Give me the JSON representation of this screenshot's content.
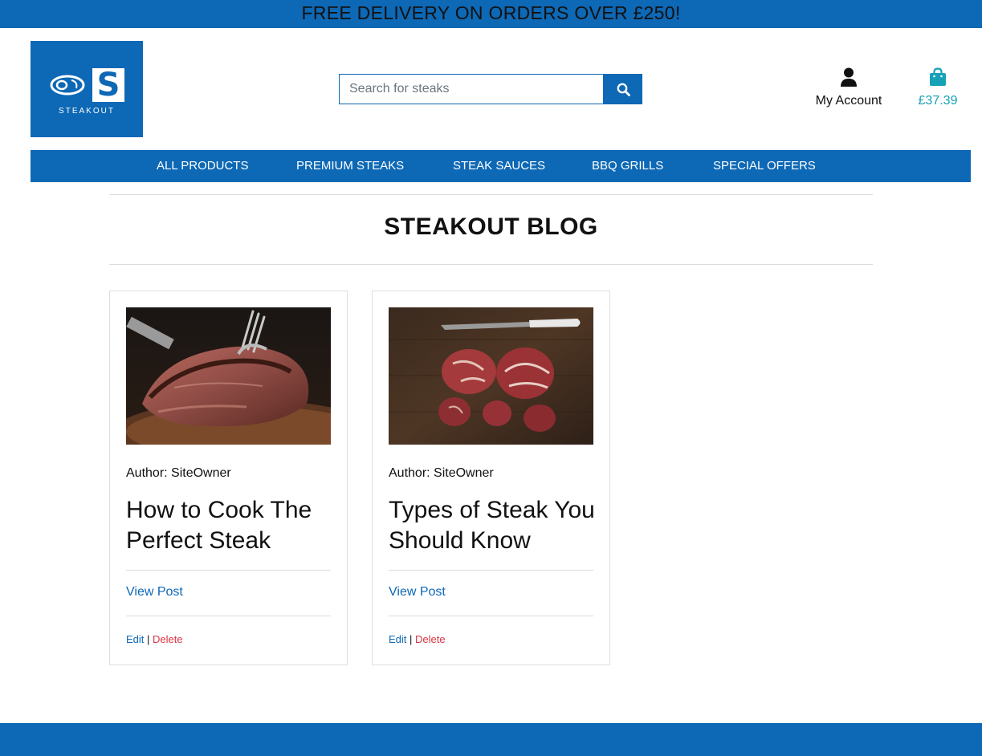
{
  "banner": {
    "text": "FREE DELIVERY ON ORDERS OVER £250!"
  },
  "logo": {
    "letter": "S",
    "text": "STEAKOUT",
    "icon": "steak-icon"
  },
  "search": {
    "placeholder": "Search for steaks",
    "icon": "search-icon"
  },
  "account": {
    "label": "My Account",
    "icon": "user-icon"
  },
  "cart": {
    "total": "£37.39",
    "icon": "shopping-bag-icon"
  },
  "nav": {
    "items": [
      {
        "label": "ALL PRODUCTS"
      },
      {
        "label": "PREMIUM STEAKS"
      },
      {
        "label": "STEAK SAUCES"
      },
      {
        "label": "BBQ GRILLS"
      },
      {
        "label": "SPECIAL OFFERS"
      }
    ]
  },
  "page": {
    "title": "STEAKOUT BLOG"
  },
  "posts": [
    {
      "author": "Author: SiteOwner",
      "title": "How to Cook The Perfect Steak",
      "view_label": "View Post",
      "edit_label": "Edit",
      "separator": "|",
      "delete_label": "Delete"
    },
    {
      "author": "Author: SiteOwner",
      "title": "Types of Steak You Should Know",
      "view_label": "View Post",
      "edit_label": "Edit",
      "separator": "|",
      "delete_label": "Delete"
    }
  ],
  "colors": {
    "brand": "#0d68b5",
    "cart": "#17a2b8",
    "delete": "#dc3545"
  }
}
